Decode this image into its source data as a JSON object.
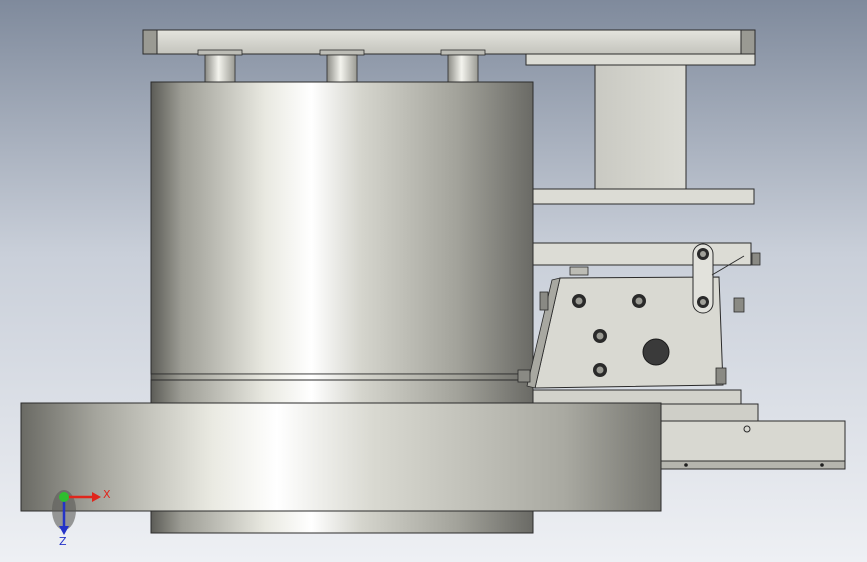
{
  "viewport": {
    "background_top": "#7f8a9c",
    "background_mid": "#c9cfd9",
    "background_bottom": "#eef0f4"
  },
  "colors": {
    "metal_light": "#f4f4ee",
    "metal_mid": "#c9c9c1",
    "metal_dark": "#6e6e69",
    "outline": "#2b2b2b",
    "bolt_dark": "#1e1e1e",
    "axis_x": "#e0261c",
    "axis_y": "#2fbf2f",
    "axis_z": "#2433c8"
  },
  "triad": {
    "x_label": "X",
    "z_label": "Z"
  }
}
